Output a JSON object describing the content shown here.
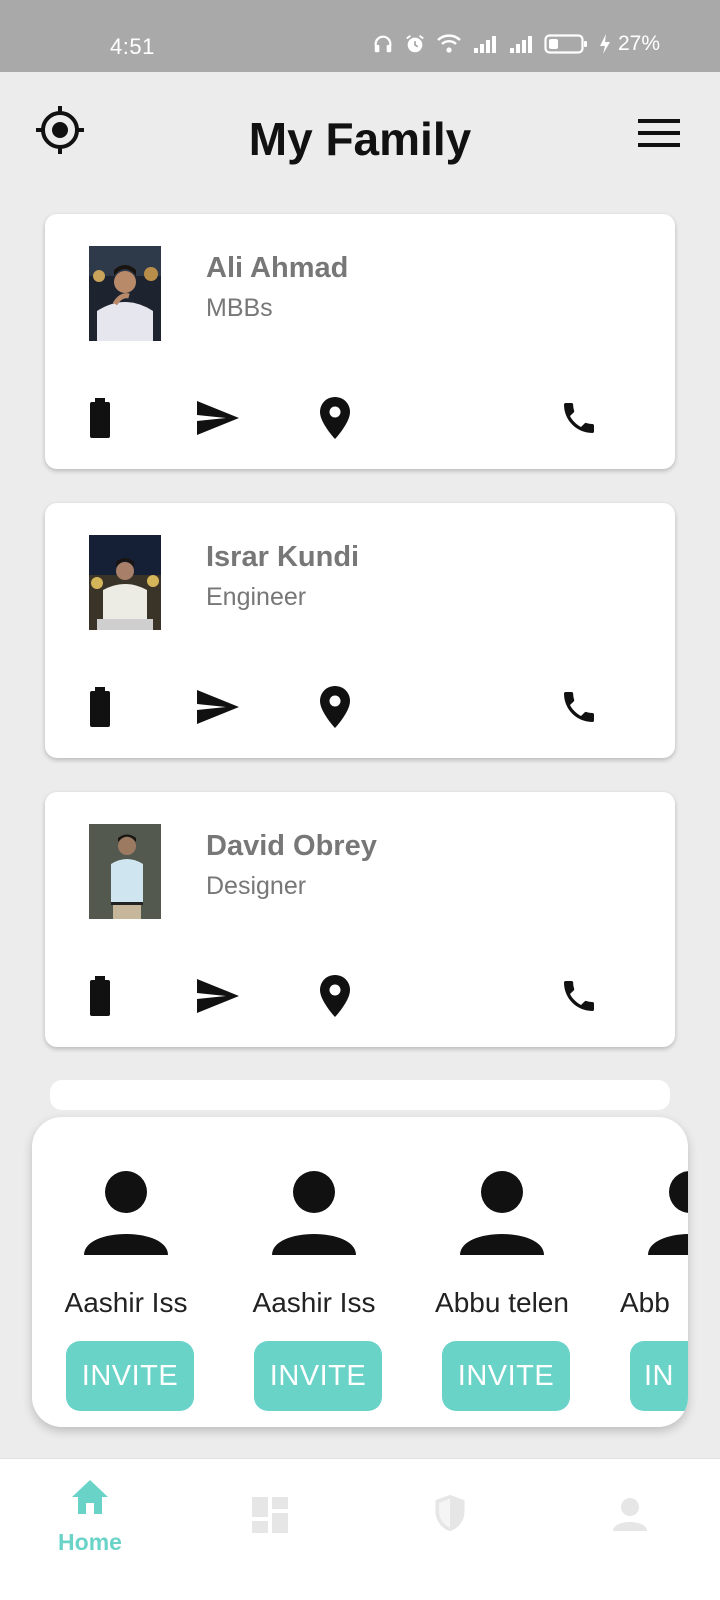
{
  "status_bar": {
    "time": "4:51",
    "battery_percent": "27%"
  },
  "header": {
    "title": "My Family"
  },
  "members": [
    {
      "name": "Ali Ahmad",
      "role": "MBBs"
    },
    {
      "name": "Israr Kundi",
      "role": "Engineer"
    },
    {
      "name": "David Obrey",
      "role": "Designer"
    }
  ],
  "member_actions": [
    "battery-icon",
    "send-icon",
    "location-pin-icon",
    "phone-icon"
  ],
  "invite": {
    "contacts": [
      {
        "name": "Aashir Iss"
      },
      {
        "name": "Aashir Iss"
      },
      {
        "name": "Abbu telen"
      },
      {
        "name": "Abb"
      }
    ],
    "button_label": "INVITE",
    "button_label_partial": "IN"
  },
  "bottom_nav": {
    "active": "Home",
    "items": [
      {
        "label": "Home",
        "icon": "home-icon"
      },
      {
        "label": "",
        "icon": "dashboard-icon"
      },
      {
        "label": "",
        "icon": "shield-icon"
      },
      {
        "label": "",
        "icon": "person-icon"
      }
    ]
  },
  "colors": {
    "accent": "#6ad3c8",
    "status_bar": "#a9a9aa",
    "background": "#ececec"
  }
}
